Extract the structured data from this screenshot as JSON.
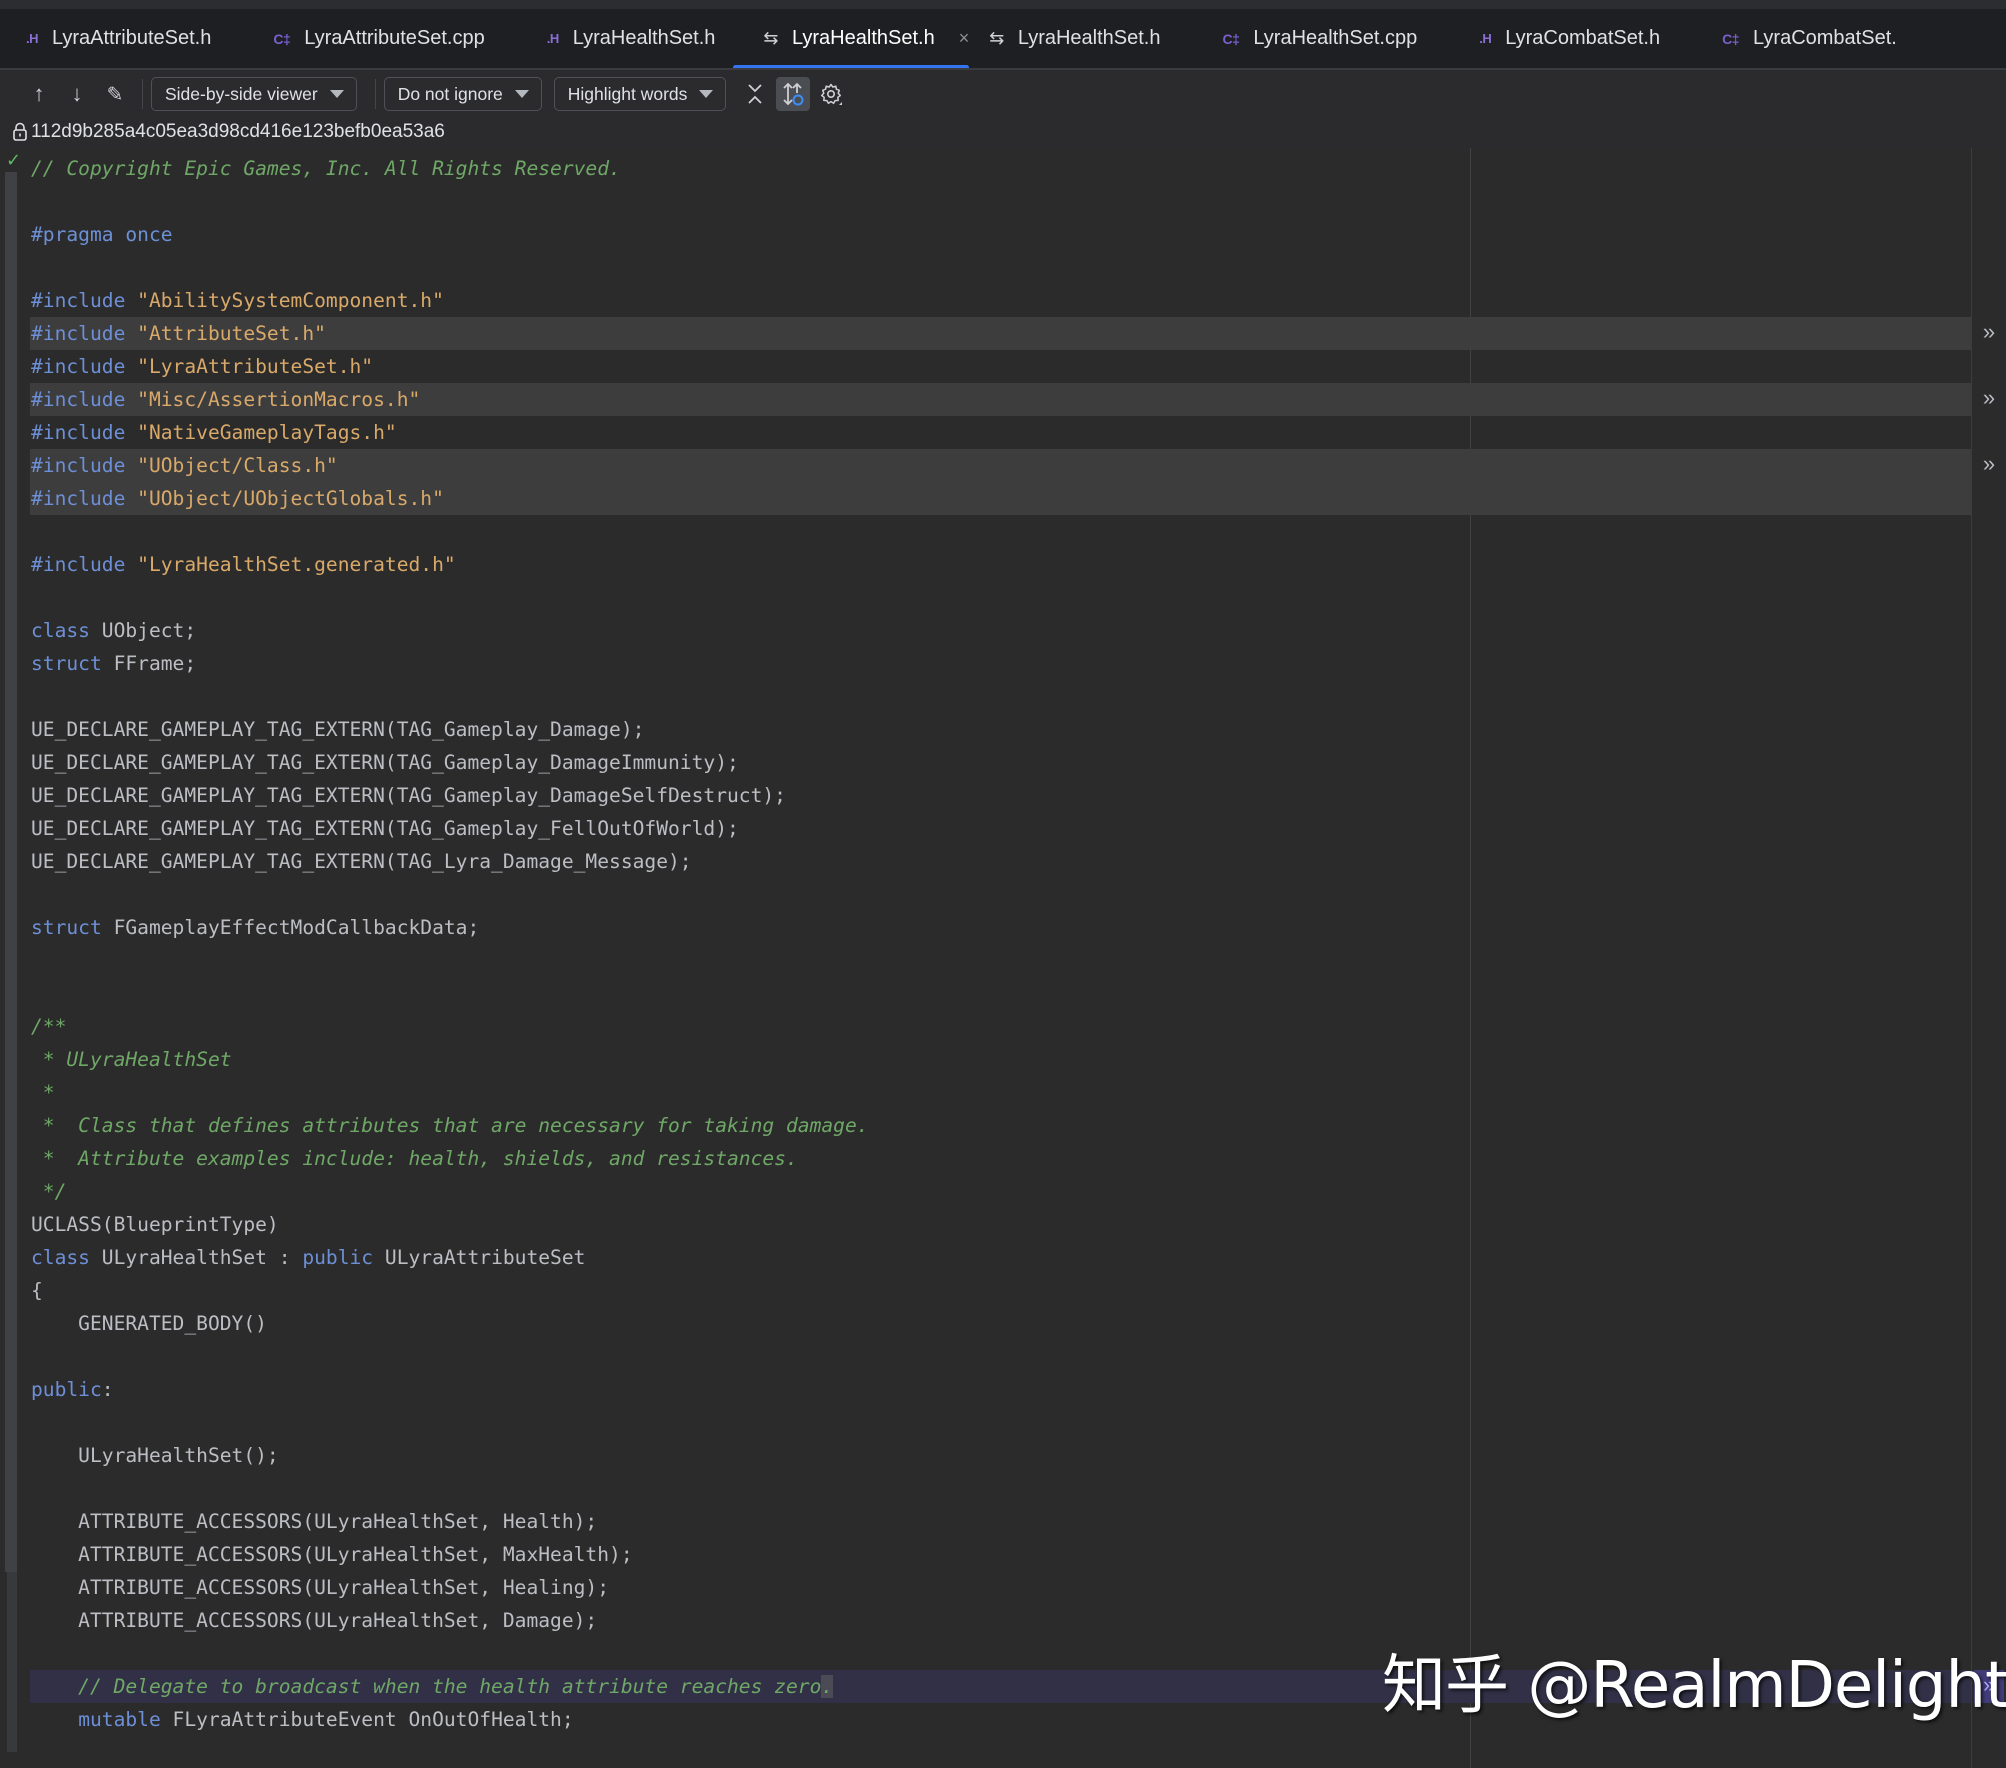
{
  "tabs": [
    {
      "label": "LyraAttributeSet.h",
      "type": "h",
      "icon": "header-file-icon",
      "icon_glyph": ".H",
      "active": false
    },
    {
      "label": "LyraAttributeSet.cpp",
      "type": "cpp",
      "icon": "cpp-file-icon",
      "icon_glyph": "C‡",
      "active": false
    },
    {
      "label": "LyraHealthSet.h",
      "type": "h",
      "icon": "header-file-icon",
      "icon_glyph": ".H",
      "active": false
    },
    {
      "label": "LyraHealthSet.h",
      "type": "diff",
      "icon": "diff-icon",
      "icon_glyph": "⇆",
      "active": true,
      "closable": true
    },
    {
      "label": "LyraHealthSet.h",
      "type": "diff",
      "icon": "diff-icon",
      "icon_glyph": "⇆",
      "active": false
    },
    {
      "label": "LyraHealthSet.cpp",
      "type": "cpp",
      "icon": "cpp-file-icon",
      "icon_glyph": "C‡",
      "active": false
    },
    {
      "label": "LyraCombatSet.h",
      "type": "h",
      "icon": "header-file-icon",
      "icon_glyph": ".H",
      "active": false
    },
    {
      "label": "LyraCombatSet.",
      "type": "cpp",
      "icon": "cpp-file-icon",
      "icon_glyph": "C‡",
      "active": false
    }
  ],
  "tab_close_glyph": "×",
  "toolbar": {
    "prev_diff": "↑",
    "next_diff": "↓",
    "edit": "✎",
    "viewer_select": "Side-by-side viewer",
    "ignore_select": "Do not ignore",
    "highlight_select": "Highlight words",
    "collapse": "✕",
    "sync_scroll": "⇅",
    "settings": "⚙"
  },
  "revision_hash": "112d9b285a4c05ea3d98cd416e123befb0ea53a6",
  "code_lines": [
    {
      "tokens": [
        {
          "t": "// Copyright Epic Games, Inc. All Rights Reserved.",
          "c": "cm"
        }
      ]
    },
    {
      "tokens": []
    },
    {
      "tokens": [
        {
          "t": "#pragma once",
          "c": "kw"
        }
      ]
    },
    {
      "tokens": []
    },
    {
      "tokens": [
        {
          "t": "#include",
          "c": "kw"
        },
        {
          "t": " "
        },
        {
          "t": "\"AbilitySystemComponent.h\"",
          "c": "str"
        }
      ]
    },
    {
      "tokens": [
        {
          "t": "#include",
          "c": "kw"
        },
        {
          "t": " "
        },
        {
          "t": "\"AttributeSet.h\"",
          "c": "str"
        }
      ],
      "hl": "gray",
      "mark": true
    },
    {
      "tokens": [
        {
          "t": "#include",
          "c": "kw"
        },
        {
          "t": " "
        },
        {
          "t": "\"LyraAttributeSet.h\"",
          "c": "str"
        }
      ]
    },
    {
      "tokens": [
        {
          "t": "#include",
          "c": "kw"
        },
        {
          "t": " "
        },
        {
          "t": "\"Misc/AssertionMacros.h\"",
          "c": "str"
        }
      ],
      "hl": "gray",
      "mark": true
    },
    {
      "tokens": [
        {
          "t": "#include",
          "c": "kw"
        },
        {
          "t": " "
        },
        {
          "t": "\"NativeGameplayTags.h\"",
          "c": "str"
        }
      ]
    },
    {
      "tokens": [
        {
          "t": "#include",
          "c": "kw"
        },
        {
          "t": " "
        },
        {
          "t": "\"UObject/Class.h\"",
          "c": "str"
        }
      ],
      "hl": "gray",
      "mark": true
    },
    {
      "tokens": [
        {
          "t": "#include",
          "c": "kw"
        },
        {
          "t": " "
        },
        {
          "t": "\"UObject/UObjectGlobals.h\"",
          "c": "str"
        }
      ],
      "hl": "gray"
    },
    {
      "tokens": []
    },
    {
      "tokens": [
        {
          "t": "#include",
          "c": "kw"
        },
        {
          "t": " "
        },
        {
          "t": "\"LyraHealthSet.generated.h\"",
          "c": "str"
        }
      ]
    },
    {
      "tokens": []
    },
    {
      "tokens": [
        {
          "t": "class",
          "c": "kw"
        },
        {
          "t": " UObject;"
        }
      ]
    },
    {
      "tokens": [
        {
          "t": "struct",
          "c": "kw"
        },
        {
          "t": " FFrame;"
        }
      ]
    },
    {
      "tokens": []
    },
    {
      "tokens": [
        {
          "t": "UE_DECLARE_GAMEPLAY_TAG_EXTERN(TAG_Gameplay_Damage);"
        }
      ]
    },
    {
      "tokens": [
        {
          "t": "UE_DECLARE_GAMEPLAY_TAG_EXTERN(TAG_Gameplay_DamageImmunity);"
        }
      ]
    },
    {
      "tokens": [
        {
          "t": "UE_DECLARE_GAMEPLAY_TAG_EXTERN(TAG_Gameplay_DamageSelfDestruct);"
        }
      ]
    },
    {
      "tokens": [
        {
          "t": "UE_DECLARE_GAMEPLAY_TAG_EXTERN(TAG_Gameplay_FellOutOfWorld);"
        }
      ]
    },
    {
      "tokens": [
        {
          "t": "UE_DECLARE_GAMEPLAY_TAG_EXTERN(TAG_Lyra_Damage_Message);"
        }
      ]
    },
    {
      "tokens": []
    },
    {
      "tokens": [
        {
          "t": "struct",
          "c": "kw"
        },
        {
          "t": " FGameplayEffectModCallbackData;"
        }
      ]
    },
    {
      "tokens": []
    },
    {
      "tokens": []
    },
    {
      "tokens": [
        {
          "t": "/**",
          "c": "cm"
        }
      ]
    },
    {
      "tokens": [
        {
          "t": " * ULyraHealthSet",
          "c": "cm"
        }
      ]
    },
    {
      "tokens": [
        {
          "t": " *",
          "c": "cm"
        }
      ]
    },
    {
      "tokens": [
        {
          "t": " *  Class that defines attributes that are necessary for taking damage.",
          "c": "cm"
        }
      ]
    },
    {
      "tokens": [
        {
          "t": " *  Attribute examples include: health, shields, and resistances.",
          "c": "cm"
        }
      ]
    },
    {
      "tokens": [
        {
          "t": " */",
          "c": "cm"
        }
      ]
    },
    {
      "tokens": [
        {
          "t": "UCLASS(BlueprintType)"
        }
      ]
    },
    {
      "tokens": [
        {
          "t": "class",
          "c": "kw"
        },
        {
          "t": " ULyraHealthSet : "
        },
        {
          "t": "public",
          "c": "kw"
        },
        {
          "t": " ULyraAttributeSet"
        }
      ]
    },
    {
      "tokens": [
        {
          "t": "{"
        }
      ]
    },
    {
      "tokens": [
        {
          "t": "    GENERATED_BODY()"
        }
      ]
    },
    {
      "tokens": []
    },
    {
      "tokens": [
        {
          "t": "public",
          "c": "kw"
        },
        {
          "t": ":"
        }
      ]
    },
    {
      "tokens": []
    },
    {
      "tokens": [
        {
          "t": "    ULyraHealthSet();"
        }
      ]
    },
    {
      "tokens": []
    },
    {
      "tokens": [
        {
          "t": "    ATTRIBUTE_ACCESSORS(ULyraHealthSet, Health);"
        }
      ]
    },
    {
      "tokens": [
        {
          "t": "    ATTRIBUTE_ACCESSORS(ULyraHealthSet, MaxHealth);"
        }
      ]
    },
    {
      "tokens": [
        {
          "t": "    ATTRIBUTE_ACCESSORS(ULyraHealthSet, Healing);"
        }
      ]
    },
    {
      "tokens": [
        {
          "t": "    ATTRIBUTE_ACCESSORS(ULyraHealthSet, Damage);"
        }
      ]
    },
    {
      "tokens": []
    },
    {
      "tokens": [
        {
          "t": "    // Delegate to broadcast when the health attribute reaches zero",
          "c": "cm"
        },
        {
          "t": ".",
          "c": "cm caret"
        }
      ],
      "hl": "purple",
      "mark": "purple"
    },
    {
      "tokens": [
        {
          "t": "    "
        },
        {
          "t": "mutable",
          "c": "kw"
        },
        {
          "t": " FLyraAttributeEvent OnOutOfHealth;"
        }
      ]
    }
  ],
  "diff_mark_glyph": "»",
  "watermark": "知乎 @RealmDelight"
}
